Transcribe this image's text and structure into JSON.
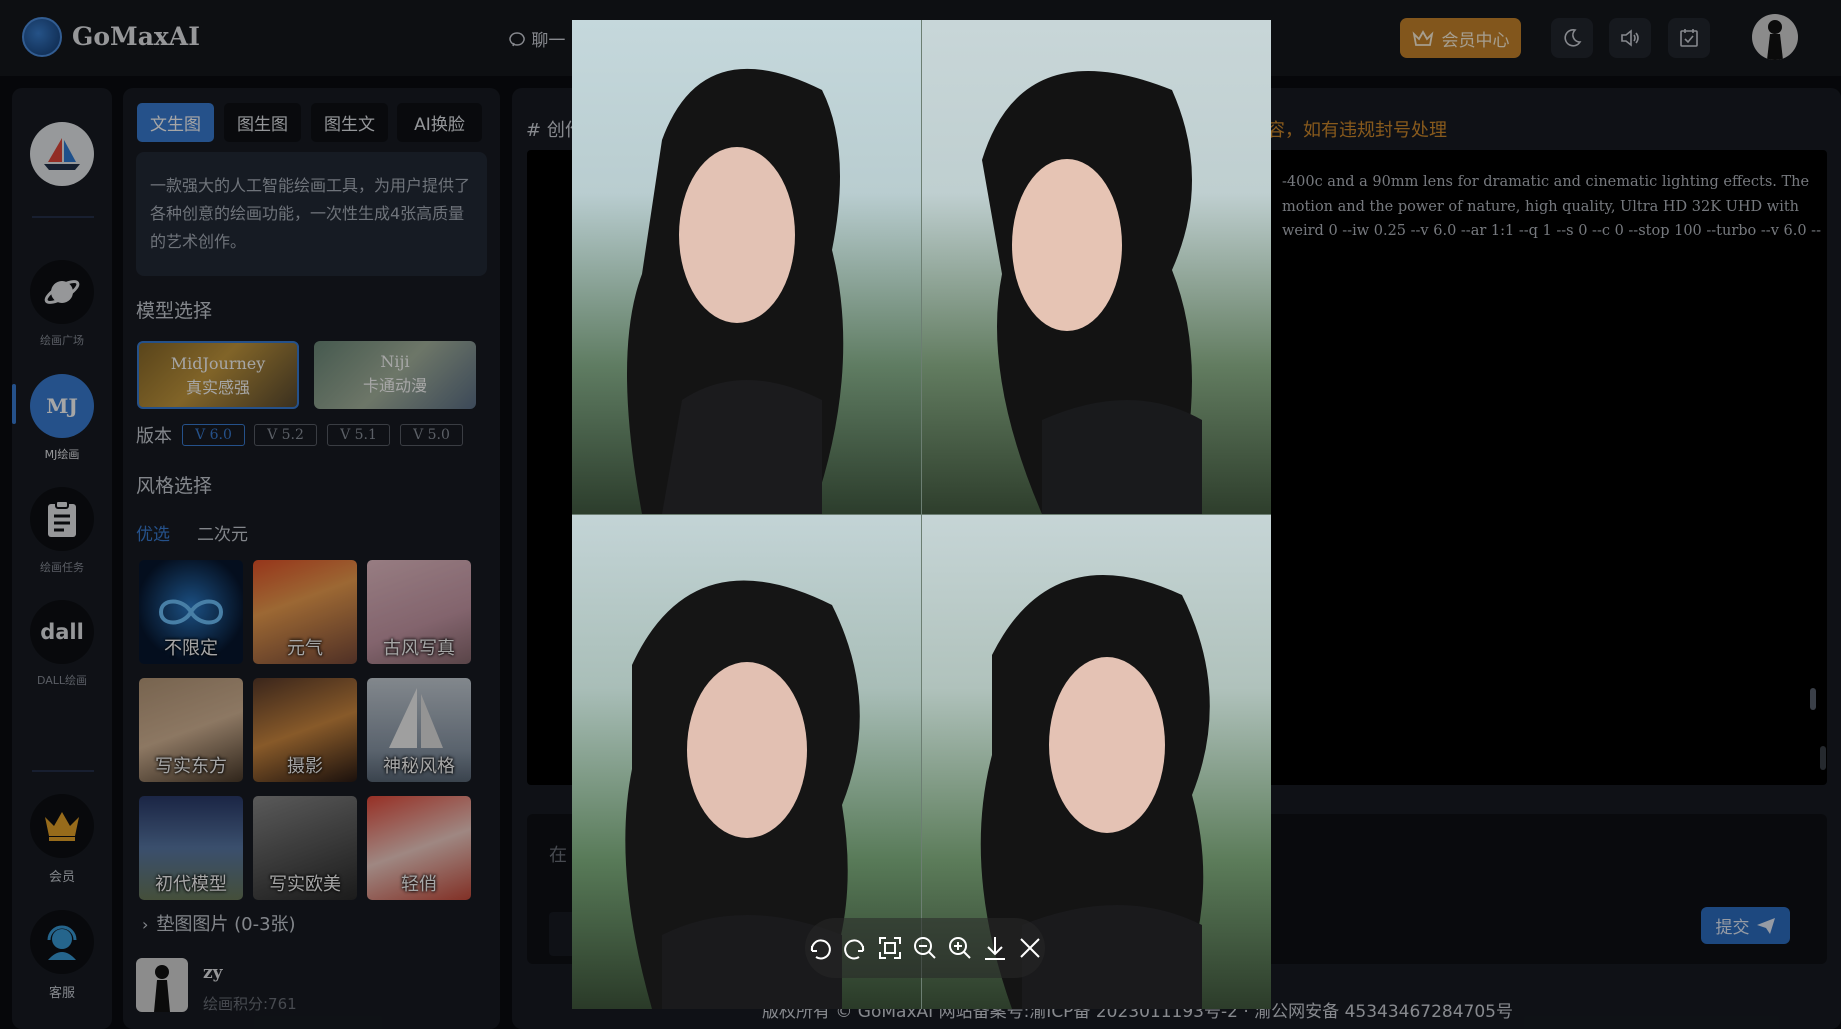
{
  "app": {
    "title": "GoMaxAI"
  },
  "header": {
    "chat_tab": "聊一",
    "vip_label": "会员中心",
    "icons": [
      "moon-icon",
      "speaker-icon",
      "calendar-check-icon"
    ]
  },
  "nav": {
    "items": [
      {
        "id": "plaza",
        "label": "绘画广场",
        "icon": "planet-icon"
      },
      {
        "id": "mj",
        "label": "MJ绘画",
        "icon_text": "MJ",
        "active": true
      },
      {
        "id": "tasks",
        "label": "绘画任务",
        "icon": "clipboard-icon"
      },
      {
        "id": "dall",
        "label": "DALL绘画",
        "icon_text": "dall"
      },
      {
        "id": "vip",
        "label": "会员",
        "icon": "crown-icon"
      },
      {
        "id": "service",
        "label": "客服",
        "icon": "support-agent-icon"
      }
    ]
  },
  "left": {
    "tabs": [
      {
        "label": "文生图",
        "active": true
      },
      {
        "label": "图生图"
      },
      {
        "label": "图生文"
      },
      {
        "label": "AI换脸"
      }
    ],
    "description": "一款强大的人工智能绘画工具，为用户提供了各种创意的绘画功能，一次性生成4张高质量的艺术创作。",
    "model_title": "模型选择",
    "models": [
      {
        "name": "MidJourney",
        "sub": "真实感强",
        "selected": true
      },
      {
        "name": "Niji",
        "sub": "卡通动漫"
      }
    ],
    "version_label": "版本",
    "versions": [
      {
        "label": "V 6.0",
        "selected": true
      },
      {
        "label": "V 5.2"
      },
      {
        "label": "V 5.1"
      },
      {
        "label": "V 5.0"
      }
    ],
    "style_title": "风格选择",
    "style_tabs": [
      {
        "label": "优选",
        "active": true
      },
      {
        "label": "二次元"
      }
    ],
    "styles": [
      {
        "label": "不限定"
      },
      {
        "label": "元气"
      },
      {
        "label": "古风写真"
      },
      {
        "label": "写实东方"
      },
      {
        "label": "摄影"
      },
      {
        "label": "神秘风格"
      },
      {
        "label": "初代模型"
      },
      {
        "label": "写实欧美"
      },
      {
        "label": "轻俏"
      }
    ],
    "pad_images": "垫图图片 (0-3张)",
    "user": {
      "name": "zy",
      "points": "绘画积分:761"
    }
  },
  "main": {
    "hash": "#",
    "title_fragment": "创作",
    "warning_fragment": "容，如有违规封号处理",
    "prompt_lines": [
      "-400c and a 90mm lens for dramatic and cinematic lighting effects. The",
      "motion and the power of nature, high quality, Ultra HD 32K UHD with",
      "weird 0 --iw 0.25 --v 6.0 --ar 1:1 --q 1 --s 0 --c 0 --stop 100 --turbo --v 6.0 --"
    ],
    "input_placeholder_fragment": "在",
    "submit_label": "提交",
    "footer_fragment": "版权所有 © GoMaxAI 网站备案号:渝ICP备 2023011193号-2 · 渝公网安备 45343467284705号"
  },
  "viewer": {
    "tools": [
      "rotate-left-icon",
      "rotate-right-icon",
      "fit-screen-icon",
      "zoom-out-icon",
      "zoom-in-icon",
      "download-icon",
      "close-icon"
    ]
  }
}
